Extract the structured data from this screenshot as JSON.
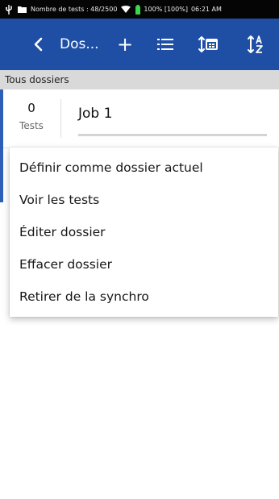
{
  "status_bar": {
    "text": "Nombre de tests : 48/2500",
    "battery_text": "100% [100%]",
    "time": "06:21 AM",
    "icons": [
      "usb-icon",
      "folder-icon",
      "wifi-icon",
      "battery-icon"
    ]
  },
  "toolbar": {
    "back_icon": "chevron-left-icon",
    "title": "Dos...",
    "add_label": "+",
    "list_icon": "list-icon",
    "sort_date_icon": "sort-by-date-icon",
    "sort_az_icon": "sort-az-icon"
  },
  "section_header": "Tous dossiers",
  "job": {
    "tests_count": "0",
    "tests_label": "Tests",
    "name": "Job 1"
  },
  "context_menu": {
    "items": [
      "Définir comme dossier actuel",
      "Voir les tests",
      "Éditer dossier",
      "Effacer dossier",
      "Retirer de la synchro"
    ]
  },
  "colors": {
    "status_bar": "#050505",
    "toolbar": "#1f4fa5",
    "accent": "#2d5fb7",
    "section_header": "#d9d9d9",
    "battery": "#3cd64a"
  }
}
